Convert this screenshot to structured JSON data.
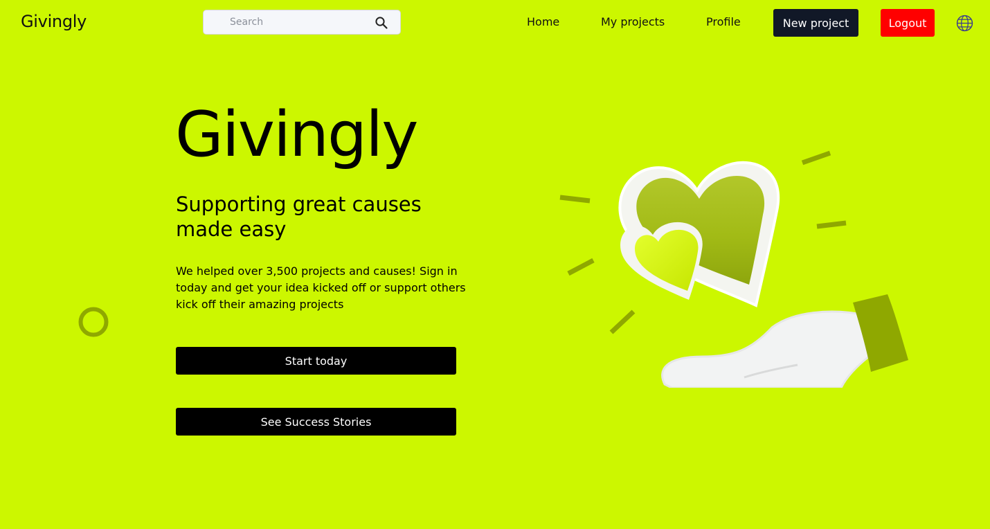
{
  "header": {
    "brand": "Givingly",
    "search": {
      "placeholder": "Search",
      "value": ""
    },
    "nav": [
      {
        "label": "Home"
      },
      {
        "label": "My projects"
      },
      {
        "label": "Profile"
      }
    ],
    "new_project_label": "New project",
    "logout_label": "Logout"
  },
  "hero": {
    "title": "Givingly",
    "subtitle": "Supporting great causes made easy",
    "description": "We helped over 3,500 projects and causes! Sign in today and get your idea kicked off or support others kick off their amazing projects",
    "primary_button": "Start today",
    "secondary_button": "See Success Stories"
  },
  "icons": {
    "search": "search-icon",
    "globe": "globe-icon"
  },
  "colors": {
    "background": "#ccf700",
    "new_project_button": "#111827",
    "logout_button": "#ff0000",
    "cta_button": "#000000",
    "accent_dark": "#8fa800"
  }
}
